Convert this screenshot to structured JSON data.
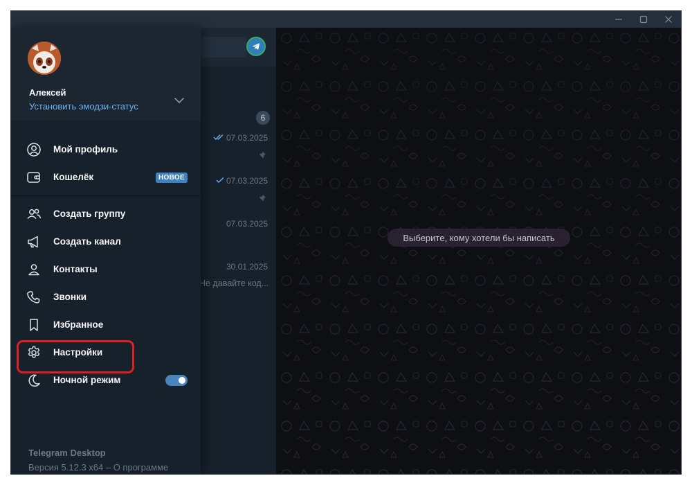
{
  "user": {
    "name": "Алексей",
    "emoji_status_link": "Установить эмодзи-статус"
  },
  "menu": {
    "items": [
      {
        "id": "my-profile",
        "label": "Мой профиль",
        "icon": "user-circle-icon"
      },
      {
        "id": "wallet",
        "label": "Кошелёк",
        "icon": "wallet-icon",
        "badge": "НОВОЕ"
      },
      {
        "id": "create-group",
        "label": "Создать группу",
        "icon": "group-icon"
      },
      {
        "id": "create-channel",
        "label": "Создать канал",
        "icon": "megaphone-icon"
      },
      {
        "id": "contacts",
        "label": "Контакты",
        "icon": "contact-icon"
      },
      {
        "id": "calls",
        "label": "Звонки",
        "icon": "phone-icon"
      },
      {
        "id": "saved",
        "label": "Избранное",
        "icon": "bookmark-icon"
      },
      {
        "id": "settings",
        "label": "Настройки",
        "icon": "gear-icon"
      },
      {
        "id": "night-mode",
        "label": "Ночной режим",
        "icon": "moon-icon",
        "toggle_on": true
      }
    ]
  },
  "footer": {
    "app_name": "Telegram Desktop",
    "version": "Версия 5.12.3 x64 – О программе"
  },
  "chat_list": {
    "unread_count": "6",
    "dates": [
      "07.03.2025",
      "07.03.2025",
      "07.03.2025",
      "30.01.2025"
    ],
    "preview": "Не давайте код..."
  },
  "chat_area": {
    "empty_hint": "Выберите, кому хотели бы написать"
  },
  "colors": {
    "menu_bg": "#17212b",
    "accent": "#6ab3f3",
    "badge": "#3e82c4",
    "highlight": "#e0201f",
    "chat_bg": "#0e0f12"
  }
}
